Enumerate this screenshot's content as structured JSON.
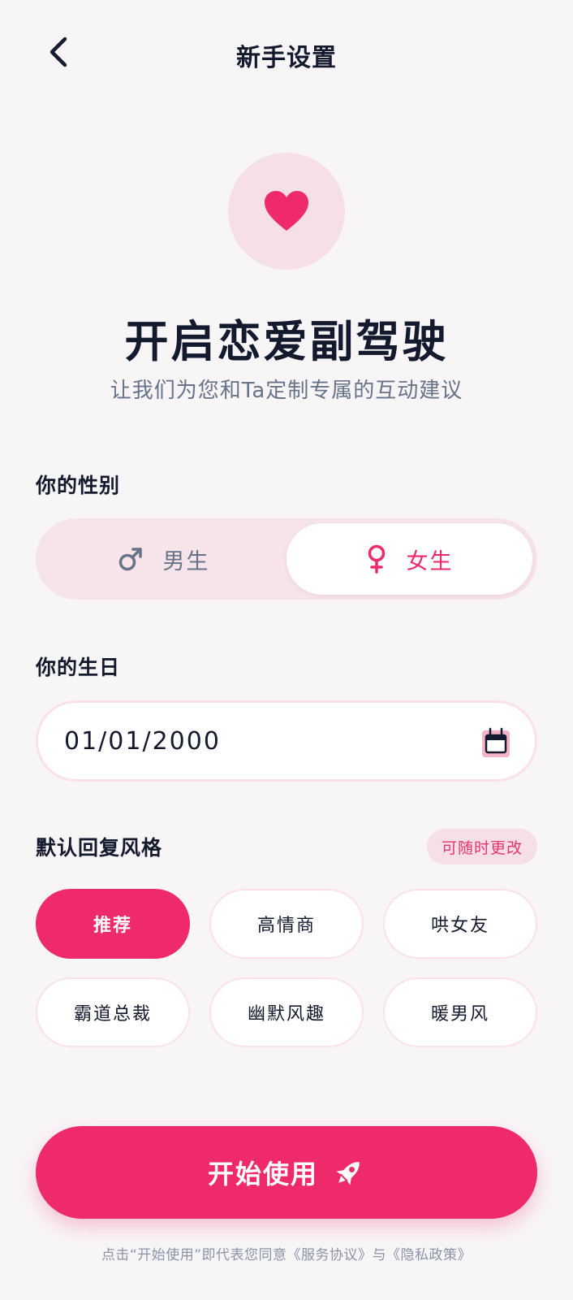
{
  "header": {
    "title": "新手设置",
    "back_icon": "chevron-left-icon"
  },
  "hero": {
    "icon": "heart-icon",
    "title": "开启恋爱副驾驶",
    "subtitle": "让我们为您和Ta定制专属的互动建议"
  },
  "gender": {
    "label": "你的性别",
    "options": [
      {
        "label": "男生",
        "icon": "male-symbol-icon",
        "selected": false
      },
      {
        "label": "女生",
        "icon": "female-symbol-icon",
        "selected": true
      }
    ]
  },
  "birthday": {
    "label": "你的生日",
    "value": "01/01/2000",
    "icon": "calendar-icon"
  },
  "reply_style": {
    "label": "默认回复风格",
    "badge": "可随时更改",
    "options": [
      {
        "label": "推荐",
        "selected": true
      },
      {
        "label": "高情商",
        "selected": false
      },
      {
        "label": "哄女友",
        "selected": false
      },
      {
        "label": "霸道总裁",
        "selected": false
      },
      {
        "label": "幽默风趣",
        "selected": false
      },
      {
        "label": "暖男风",
        "selected": false
      }
    ]
  },
  "start_button": {
    "label": "开始使用",
    "icon": "rocket-icon"
  },
  "footer": {
    "note": "点击“开始使用”即代表您同意《服务协议》与《隐私政策》"
  },
  "colors": {
    "accent": "#ee2a6b",
    "background": "#f8f5f7",
    "text": "#141a2e",
    "muted": "#667388"
  }
}
